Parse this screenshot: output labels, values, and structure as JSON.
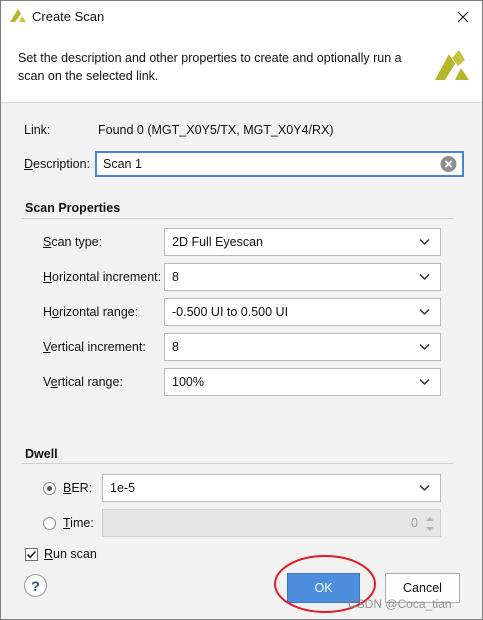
{
  "window": {
    "title": "Create Scan"
  },
  "header": {
    "description": "Set the description and other properties to create and optionally run a scan on the selected link."
  },
  "link": {
    "label": "Link:",
    "value": "Found 0 (MGT_X0Y5/TX, MGT_X0Y4/RX)"
  },
  "description": {
    "label_hotkey": "D",
    "label_rest": "escription:",
    "value": "Scan 1"
  },
  "scan_properties": {
    "title": "Scan Properties",
    "scan_type": {
      "label_hotkey": "S",
      "label_rest": "can type:",
      "value": "2D Full Eyescan"
    },
    "horizontal_increment": {
      "label_hotkey": "H",
      "label_rest": "orizontal increment:",
      "value": "8"
    },
    "horizontal_range": {
      "label_pre": "H",
      "label_hotkey": "o",
      "label_rest": "rizontal range:",
      "value": "-0.500 UI to 0.500 UI"
    },
    "vertical_increment": {
      "label_hotkey": "V",
      "label_rest": "ertical increment:",
      "value": "8"
    },
    "vertical_range": {
      "label_pre": "V",
      "label_hotkey": "e",
      "label_rest": "rtical range:",
      "value": "100%"
    }
  },
  "dwell": {
    "title": "Dwell",
    "ber": {
      "label_hotkey": "B",
      "label_rest": "ER:",
      "value": "1e-5",
      "selected": true
    },
    "time": {
      "label_hotkey": "T",
      "label_rest": "ime:",
      "value": "0",
      "selected": false
    }
  },
  "run_scan": {
    "label_hotkey": "R",
    "label_rest": "un scan",
    "checked": true
  },
  "buttons": {
    "help": "?",
    "ok": "OK",
    "cancel": "Cancel"
  },
  "watermark": "CSDN @Coca_tian",
  "colors": {
    "accent": "#4d8ede",
    "logo": "#b5b72a",
    "annotation": "#e01c24"
  }
}
